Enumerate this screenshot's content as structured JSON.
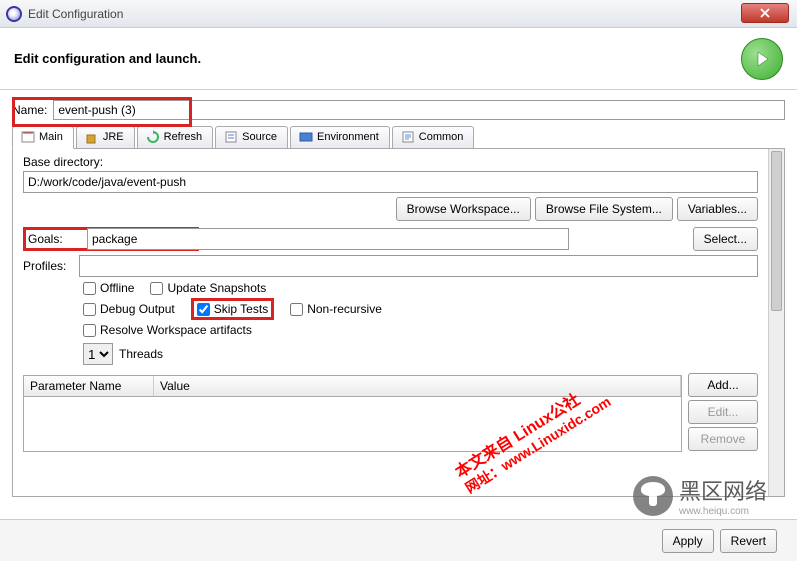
{
  "window": {
    "title": "Edit Configuration"
  },
  "header": {
    "title": "Edit configuration and launch."
  },
  "form": {
    "name_label": "Name:",
    "name_value": "event-push (3)",
    "base_dir_label": "Base directory:",
    "base_dir_value": "D:/work/code/java/event-push",
    "goals_label": "Goals:",
    "goals_value": "package",
    "profiles_label": "Profiles:",
    "profiles_value": "",
    "threads_label": "Threads",
    "threads_value": "1"
  },
  "tabs": {
    "main": "Main",
    "jre": "JRE",
    "refresh": "Refresh",
    "source": "Source",
    "environment": "Environment",
    "common": "Common"
  },
  "buttons": {
    "browse_workspace": "Browse Workspace...",
    "browse_fs": "Browse File System...",
    "variables": "Variables...",
    "select": "Select...",
    "add": "Add...",
    "edit": "Edit...",
    "remove": "Remove",
    "apply": "Apply",
    "revert": "Revert"
  },
  "checkboxes": {
    "offline": "Offline",
    "update_snapshots": "Update Snapshots",
    "debug_output": "Debug Output",
    "skip_tests": "Skip Tests",
    "non_recursive": "Non-recursive",
    "resolve_workspace": "Resolve Workspace artifacts"
  },
  "table": {
    "col_name": "Parameter Name",
    "col_value": "Value"
  },
  "watermark": {
    "line1": "本文来自 Linux公社",
    "line2": "网址：www.Linuxidc.com"
  },
  "logo": {
    "text": "黑区网络",
    "sub": "www.heiqu.com"
  }
}
